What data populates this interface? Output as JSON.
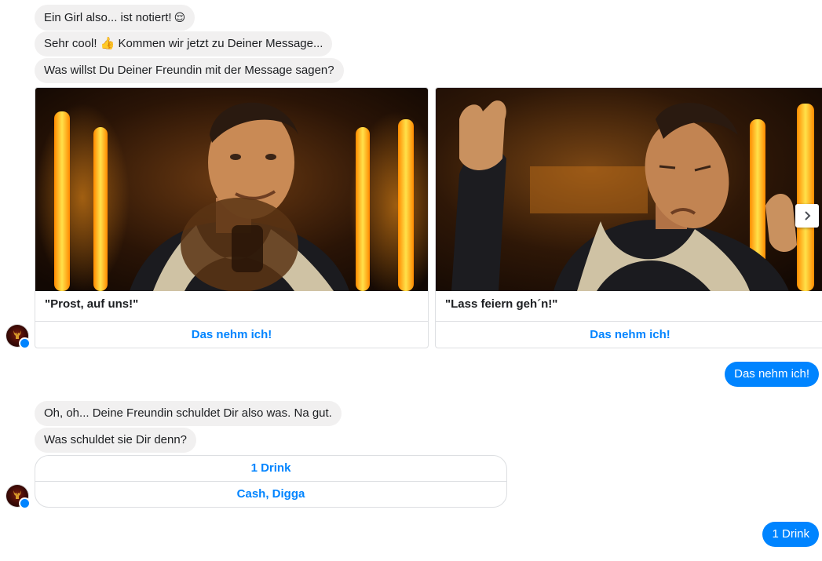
{
  "messages_in_1": [
    {
      "text": "Ein Girl also... ist notiert!",
      "emoji": "😌"
    },
    {
      "text": "Sehr cool! 👍 Kommen wir jetzt zu Deiner Message..."
    },
    {
      "text": "Was willst Du Deiner Freundin mit der Message sagen?"
    }
  ],
  "carousel": {
    "cards": [
      {
        "title": "\"Prost, auf uns!\"",
        "button": "Das nehm ich!"
      },
      {
        "title": "\"Lass feiern geh´n!\"",
        "button": "Das nehm ich!"
      }
    ],
    "next_icon": "chevron-right-icon"
  },
  "reply_1": "Das nehm ich!",
  "messages_in_2": [
    {
      "text": "Oh, oh... Deine Freundin schuldet Dir also was. Na gut."
    },
    {
      "text": "Was schuldet sie Dir denn?"
    }
  ],
  "quick_replies": [
    "1 Drink",
    "Cash, Digga"
  ],
  "reply_2": "1 Drink",
  "colors": {
    "accent": "#0084ff",
    "bubble_in": "#f1f0f0"
  }
}
